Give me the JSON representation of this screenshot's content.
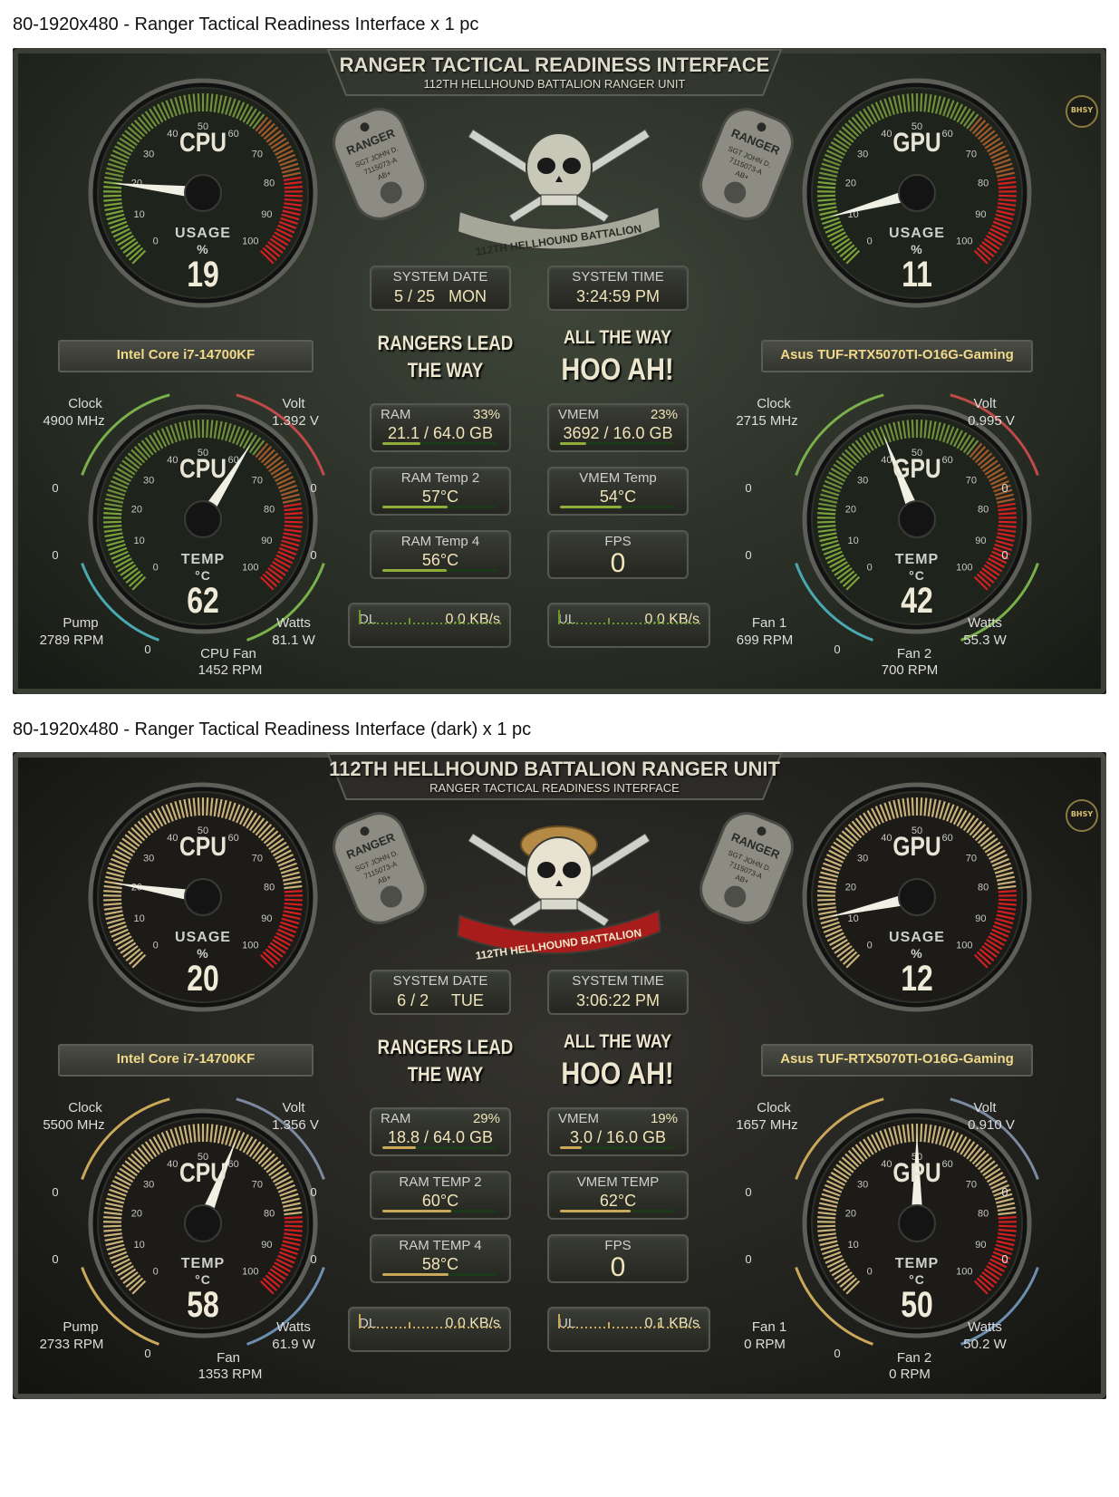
{
  "captions": {
    "light": "80-1920x480 - Ranger Tactical Readiness Interface x 1 pc",
    "dark": "80-1920x480 - Ranger Tactical Readiness Interface (dark) x 1 pc"
  },
  "ticks": [
    "0",
    "10",
    "20",
    "30",
    "40",
    "50",
    "60",
    "70",
    "80",
    "90",
    "100"
  ],
  "panel_light": {
    "title": "RANGER TACTICAL READINESS INTERFACE",
    "subtitle": "112TH HELLHOUND BATTALION RANGER UNIT",
    "emblem_banner": "112TH HELLHOUND BATTALION",
    "dogtag_text": "RANGER",
    "dogtag_lines": [
      "SGT JOHN D.",
      "7115073-A",
      "AB+"
    ],
    "badge": "BHSY",
    "cpu_usage": {
      "name": "CPU",
      "sub": "USAGE",
      "unit": "%",
      "value": "19",
      "level": 19
    },
    "gpu_usage": {
      "name": "GPU",
      "sub": "USAGE",
      "unit": "%",
      "value": "11",
      "level": 11
    },
    "cpu_model": "Intel Core i7-14700KF",
    "gpu_model": "Asus TUF-RTX5070TI-O16G-Gaming",
    "date": {
      "label": "SYSTEM DATE",
      "value": "5 / 25   MON"
    },
    "time": {
      "label": "SYSTEM TIME",
      "value": "3:24:59 PM"
    },
    "slogan_left": [
      "RANGERS LEAD",
      "THE WAY"
    ],
    "slogan_right": [
      "ALL THE WAY",
      "HOO AH!"
    ],
    "ram": {
      "label": "RAM",
      "pct": "33%",
      "value": "21.1 / 64.0 GB"
    },
    "vmem": {
      "label": "VMEM",
      "pct": "23%",
      "value": "3692 / 16.0 GB"
    },
    "ram_temp2": {
      "label": "RAM Temp 2",
      "value": "57°C"
    },
    "vmem_temp": {
      "label": "VMEM Temp",
      "value": "54°C"
    },
    "ram_temp4": {
      "label": "RAM Temp 4",
      "value": "56°C"
    },
    "fps": {
      "label": "FPS",
      "value": "0"
    },
    "dl": {
      "label": "DL",
      "value": "0.0 KB/s"
    },
    "ul": {
      "label": "UL",
      "value": "0.0 KB/s"
    },
    "cpu_temp": {
      "name": "CPU",
      "sub": "TEMP",
      "unit": "°C",
      "value": "62",
      "level": 62,
      "clock_label": "Clock",
      "clock_value": "4900 MHz",
      "volt_label": "Volt",
      "volt_value": "1.392 V",
      "pump_label": "Pump",
      "pump_value": "2789 RPM",
      "watts_label": "Watts",
      "watts_value": "81.1 W",
      "fan_label": "CPU Fan",
      "fan_value": "1452 RPM",
      "zero": "0"
    },
    "gpu_temp": {
      "name": "GPU",
      "sub": "TEMP",
      "unit": "°C",
      "value": "42",
      "level": 42,
      "clock_label": "Clock",
      "clock_value": "2715 MHz",
      "volt_label": "Volt",
      "volt_value": "0.995 V",
      "fan1_label": "Fan 1",
      "fan1_value": "699 RPM",
      "watts_label": "Watts",
      "watts_value": "55.3 W",
      "fan2_label": "Fan 2",
      "fan2_value": "700 RPM",
      "zero": "0"
    },
    "colors": {
      "bg": "#2b2f28",
      "accent": "#8fae3a",
      "red": "#c42020"
    }
  },
  "panel_dark": {
    "title": "112TH HELLHOUND BATTALION RANGER UNIT",
    "subtitle": "RANGER TACTICAL READINESS INTERFACE",
    "emblem_banner": "112TH HELLHOUND BATTALION",
    "dogtag_text": "RANGER",
    "dogtag_lines": [
      "SGT JOHN D.",
      "7115073-A",
      "AB+"
    ],
    "badge": "BHSY",
    "cpu_usage": {
      "name": "CPU",
      "sub": "USAGE",
      "unit": "%",
      "value": "20",
      "level": 20
    },
    "gpu_usage": {
      "name": "GPU",
      "sub": "USAGE",
      "unit": "%",
      "value": "12",
      "level": 12
    },
    "cpu_model": "Intel Core i7-14700KF",
    "gpu_model": "Asus TUF-RTX5070TI-O16G-Gaming",
    "date": {
      "label": "SYSTEM DATE",
      "value": "6 / 2     TUE"
    },
    "time": {
      "label": "SYSTEM TIME",
      "value": "3:06:22 PM"
    },
    "slogan_left": [
      "RANGERS LEAD",
      "THE WAY"
    ],
    "slogan_right": [
      "ALL THE WAY",
      "HOO AH!"
    ],
    "ram": {
      "label": "RAM",
      "pct": "29%",
      "value": "18.8 / 64.0 GB"
    },
    "vmem": {
      "label": "VMEM",
      "pct": "19%",
      "value": "3.0 / 16.0 GB"
    },
    "ram_temp2": {
      "label": "RAM TEMP 2",
      "value": "60°C"
    },
    "vmem_temp": {
      "label": "VMEM TEMP",
      "value": "62°C"
    },
    "ram_temp4": {
      "label": "RAM TEMP 4",
      "value": "58°C"
    },
    "fps": {
      "label": "FPS",
      "value": "0"
    },
    "dl": {
      "label": "DL",
      "value": "0.0 KB/s"
    },
    "ul": {
      "label": "UL",
      "value": "0.1 KB/s"
    },
    "cpu_temp": {
      "name": "CPU",
      "sub": "TEMP",
      "unit": "°C",
      "value": "58",
      "level": 58,
      "clock_label": "Clock",
      "clock_value": "5500 MHz",
      "volt_label": "Volt",
      "volt_value": "1.356 V",
      "pump_label": "Pump",
      "pump_value": "2733 RPM",
      "watts_label": "Watts",
      "watts_value": "61.9 W",
      "fan_label": "Fan",
      "fan_value": "1353 RPM",
      "zero": "0"
    },
    "gpu_temp": {
      "name": "GPU",
      "sub": "TEMP",
      "unit": "°C",
      "value": "50",
      "level": 50,
      "clock_label": "Clock",
      "clock_value": "1657 MHz",
      "volt_label": "Volt",
      "volt_value": "0.910 V",
      "fan1_label": "Fan 1",
      "fan1_value": "0 RPM",
      "watts_label": "Watts",
      "watts_value": "50.2 W",
      "fan2_label": "Fan 2",
      "fan2_value": "0 RPM",
      "zero": "0"
    },
    "colors": {
      "bg": "#1f1f1c",
      "accent": "#c9a85a",
      "red": "#c42020"
    }
  }
}
